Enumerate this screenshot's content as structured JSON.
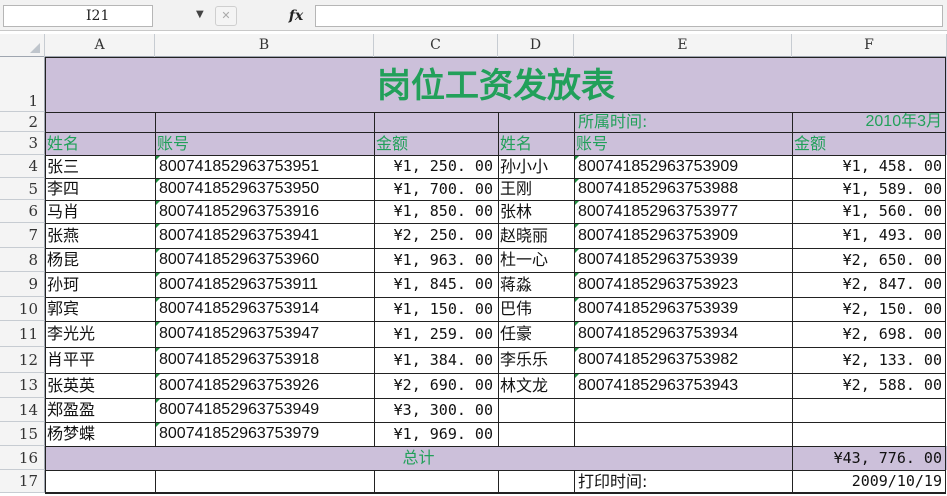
{
  "formula_bar": {
    "cell_ref": "I21",
    "fx_label": "fx",
    "cancel_label": "✕",
    "formula": ""
  },
  "columns": [
    "A",
    "B",
    "C",
    "D",
    "E",
    "F"
  ],
  "rows": [
    "1",
    "2",
    "3",
    "4",
    "5",
    "6",
    "7",
    "8",
    "9",
    "10",
    "11",
    "12",
    "13",
    "14",
    "15",
    "16",
    "17"
  ],
  "sheet": {
    "title": "岗位工资发放表",
    "period_label": "所属时间:",
    "period_value": "2010年3月",
    "headers": {
      "name1": "姓名",
      "acct1": "账号",
      "amt1": "金额",
      "name2": "姓名",
      "acct2": "账号",
      "amt2": "金额"
    },
    "left": [
      {
        "name": "张三",
        "acct": "800741852963753951",
        "amt": "¥1, 250. 00"
      },
      {
        "name": "李四",
        "acct": "800741852963753950",
        "amt": "¥1, 700. 00"
      },
      {
        "name": "马肖",
        "acct": "800741852963753916",
        "amt": "¥1, 850. 00"
      },
      {
        "name": "张燕",
        "acct": "800741852963753941",
        "amt": "¥2, 250. 00"
      },
      {
        "name": "杨昆",
        "acct": "800741852963753960",
        "amt": "¥1, 963. 00"
      },
      {
        "name": "孙珂",
        "acct": "800741852963753911",
        "amt": "¥1, 845. 00"
      },
      {
        "name": "郭宾",
        "acct": "800741852963753914",
        "amt": "¥1, 150. 00"
      },
      {
        "name": "李光光",
        "acct": "800741852963753947",
        "amt": "¥1, 259. 00"
      },
      {
        "name": "肖平平",
        "acct": "800741852963753918",
        "amt": "¥1, 384. 00"
      },
      {
        "name": "张英英",
        "acct": "800741852963753926",
        "amt": "¥2, 690. 00"
      },
      {
        "name": "郑盈盈",
        "acct": "800741852963753949",
        "amt": "¥3, 300. 00"
      },
      {
        "name": "杨梦蝶",
        "acct": "800741852963753979",
        "amt": "¥1, 969. 00"
      }
    ],
    "right": [
      {
        "name": "孙小小",
        "acct": "800741852963753909",
        "amt": "¥1, 458. 00"
      },
      {
        "name": "王刚",
        "acct": "800741852963753988",
        "amt": "¥1, 589. 00"
      },
      {
        "name": "张林",
        "acct": "800741852963753977",
        "amt": "¥1, 560. 00"
      },
      {
        "name": "赵晓丽",
        "acct": "800741852963753909",
        "amt": "¥1, 493. 00"
      },
      {
        "name": "杜一心",
        "acct": "800741852963753939",
        "amt": "¥2, 650. 00"
      },
      {
        "name": "蒋淼",
        "acct": "800741852963753923",
        "amt": "¥2, 847. 00"
      },
      {
        "name": "巴伟",
        "acct": "800741852963753939",
        "amt": "¥2, 150. 00"
      },
      {
        "name": "任豪",
        "acct": "800741852963753934",
        "amt": "¥2, 698. 00"
      },
      {
        "name": "李乐乐",
        "acct": "800741852963753982",
        "amt": "¥2, 133. 00"
      },
      {
        "name": "林文龙",
        "acct": "800741852963753943",
        "amt": "¥2, 588. 00"
      }
    ],
    "total_label": "总计",
    "total_value": "¥43, 776. 00",
    "print_label": "打印时间:",
    "print_value": "2009/10/19"
  },
  "colors": {
    "title_band": "#ccc0da",
    "accent_green": "#22a05a"
  }
}
